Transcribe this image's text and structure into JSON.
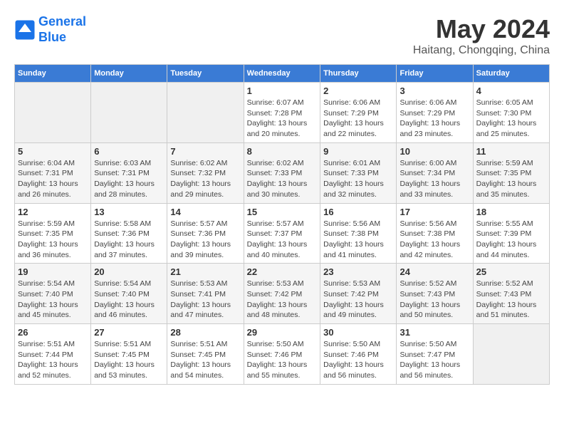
{
  "header": {
    "logo_line1": "General",
    "logo_line2": "Blue",
    "month": "May 2024",
    "location": "Haitang, Chongqing, China"
  },
  "weekdays": [
    "Sunday",
    "Monday",
    "Tuesday",
    "Wednesday",
    "Thursday",
    "Friday",
    "Saturday"
  ],
  "weeks": [
    [
      {
        "day": "",
        "info": ""
      },
      {
        "day": "",
        "info": ""
      },
      {
        "day": "",
        "info": ""
      },
      {
        "day": "1",
        "info": "Sunrise: 6:07 AM\nSunset: 7:28 PM\nDaylight: 13 hours and 20 minutes."
      },
      {
        "day": "2",
        "info": "Sunrise: 6:06 AM\nSunset: 7:29 PM\nDaylight: 13 hours and 22 minutes."
      },
      {
        "day": "3",
        "info": "Sunrise: 6:06 AM\nSunset: 7:29 PM\nDaylight: 13 hours and 23 minutes."
      },
      {
        "day": "4",
        "info": "Sunrise: 6:05 AM\nSunset: 7:30 PM\nDaylight: 13 hours and 25 minutes."
      }
    ],
    [
      {
        "day": "5",
        "info": "Sunrise: 6:04 AM\nSunset: 7:31 PM\nDaylight: 13 hours and 26 minutes."
      },
      {
        "day": "6",
        "info": "Sunrise: 6:03 AM\nSunset: 7:31 PM\nDaylight: 13 hours and 28 minutes."
      },
      {
        "day": "7",
        "info": "Sunrise: 6:02 AM\nSunset: 7:32 PM\nDaylight: 13 hours and 29 minutes."
      },
      {
        "day": "8",
        "info": "Sunrise: 6:02 AM\nSunset: 7:33 PM\nDaylight: 13 hours and 30 minutes."
      },
      {
        "day": "9",
        "info": "Sunrise: 6:01 AM\nSunset: 7:33 PM\nDaylight: 13 hours and 32 minutes."
      },
      {
        "day": "10",
        "info": "Sunrise: 6:00 AM\nSunset: 7:34 PM\nDaylight: 13 hours and 33 minutes."
      },
      {
        "day": "11",
        "info": "Sunrise: 5:59 AM\nSunset: 7:35 PM\nDaylight: 13 hours and 35 minutes."
      }
    ],
    [
      {
        "day": "12",
        "info": "Sunrise: 5:59 AM\nSunset: 7:35 PM\nDaylight: 13 hours and 36 minutes."
      },
      {
        "day": "13",
        "info": "Sunrise: 5:58 AM\nSunset: 7:36 PM\nDaylight: 13 hours and 37 minutes."
      },
      {
        "day": "14",
        "info": "Sunrise: 5:57 AM\nSunset: 7:36 PM\nDaylight: 13 hours and 39 minutes."
      },
      {
        "day": "15",
        "info": "Sunrise: 5:57 AM\nSunset: 7:37 PM\nDaylight: 13 hours and 40 minutes."
      },
      {
        "day": "16",
        "info": "Sunrise: 5:56 AM\nSunset: 7:38 PM\nDaylight: 13 hours and 41 minutes."
      },
      {
        "day": "17",
        "info": "Sunrise: 5:56 AM\nSunset: 7:38 PM\nDaylight: 13 hours and 42 minutes."
      },
      {
        "day": "18",
        "info": "Sunrise: 5:55 AM\nSunset: 7:39 PM\nDaylight: 13 hours and 44 minutes."
      }
    ],
    [
      {
        "day": "19",
        "info": "Sunrise: 5:54 AM\nSunset: 7:40 PM\nDaylight: 13 hours and 45 minutes."
      },
      {
        "day": "20",
        "info": "Sunrise: 5:54 AM\nSunset: 7:40 PM\nDaylight: 13 hours and 46 minutes."
      },
      {
        "day": "21",
        "info": "Sunrise: 5:53 AM\nSunset: 7:41 PM\nDaylight: 13 hours and 47 minutes."
      },
      {
        "day": "22",
        "info": "Sunrise: 5:53 AM\nSunset: 7:42 PM\nDaylight: 13 hours and 48 minutes."
      },
      {
        "day": "23",
        "info": "Sunrise: 5:53 AM\nSunset: 7:42 PM\nDaylight: 13 hours and 49 minutes."
      },
      {
        "day": "24",
        "info": "Sunrise: 5:52 AM\nSunset: 7:43 PM\nDaylight: 13 hours and 50 minutes."
      },
      {
        "day": "25",
        "info": "Sunrise: 5:52 AM\nSunset: 7:43 PM\nDaylight: 13 hours and 51 minutes."
      }
    ],
    [
      {
        "day": "26",
        "info": "Sunrise: 5:51 AM\nSunset: 7:44 PM\nDaylight: 13 hours and 52 minutes."
      },
      {
        "day": "27",
        "info": "Sunrise: 5:51 AM\nSunset: 7:45 PM\nDaylight: 13 hours and 53 minutes."
      },
      {
        "day": "28",
        "info": "Sunrise: 5:51 AM\nSunset: 7:45 PM\nDaylight: 13 hours and 54 minutes."
      },
      {
        "day": "29",
        "info": "Sunrise: 5:50 AM\nSunset: 7:46 PM\nDaylight: 13 hours and 55 minutes."
      },
      {
        "day": "30",
        "info": "Sunrise: 5:50 AM\nSunset: 7:46 PM\nDaylight: 13 hours and 56 minutes."
      },
      {
        "day": "31",
        "info": "Sunrise: 5:50 AM\nSunset: 7:47 PM\nDaylight: 13 hours and 56 minutes."
      },
      {
        "day": "",
        "info": ""
      }
    ]
  ]
}
